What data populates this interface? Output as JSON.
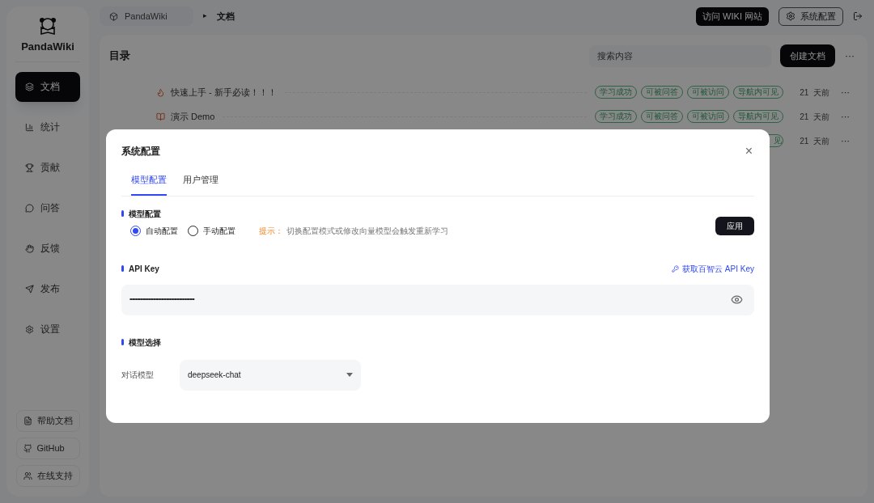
{
  "sidebar": {
    "brand": "PandaWiki",
    "items": [
      {
        "label": "文档",
        "selected": true
      },
      {
        "label": "统计",
        "selected": false
      },
      {
        "label": "贡献",
        "selected": false
      },
      {
        "label": "问答",
        "selected": false
      },
      {
        "label": "反馈",
        "selected": false
      },
      {
        "label": "发布",
        "selected": false
      },
      {
        "label": "设置",
        "selected": false
      }
    ],
    "footer_links": [
      "帮助文档",
      "GitHub",
      "在线支持"
    ]
  },
  "breadcrumb": {
    "root": "PandaWiki",
    "separator": "▸",
    "current": "文档"
  },
  "header_buttons": {
    "visit": "访问 WIKI 网站",
    "settings": "系统配置"
  },
  "catalog": {
    "title": "目录",
    "search": {
      "placeholder": "搜索内容"
    },
    "create": "创建文档",
    "more": "···",
    "rows": [
      {
        "title": "快速上手 - 新手必读！！！",
        "tags": [
          "学习成功",
          "可被问答",
          "可被访问",
          "导航内可见"
        ],
        "time": "21  天前",
        "more": "···"
      },
      {
        "title": "演示 Demo",
        "tags": [
          "学习成功",
          "可被问答",
          "可被访问",
          "导航内可见"
        ],
        "time": "21  天前",
        "more": "···"
      },
      {
        "tags": [
          "见"
        ],
        "time": "21  天前",
        "more": "···"
      }
    ]
  },
  "dialog": {
    "title": "系统配置",
    "close": "×",
    "tabs": [
      {
        "label": "模型配置",
        "selected": true
      },
      {
        "label": "用户管理",
        "selected": false
      }
    ],
    "mode_section": {
      "title": "模型配置",
      "options": [
        {
          "label": "自动配置",
          "selected": true
        },
        {
          "label": "手动配置",
          "selected": false
        }
      ],
      "hint_label": "提示：",
      "hint": "切换配置模式或修改向量模型会触发重新学习",
      "apply": "应用"
    },
    "api_section": {
      "title": "API Key",
      "link": "获取百智云 API Key",
      "value": "•••••••••••••••••••••••••••••••••••••••••••••••••••••••"
    },
    "model_section": {
      "title": "模型选择",
      "label": "对话模型",
      "value": "deepseek-chat"
    }
  }
}
